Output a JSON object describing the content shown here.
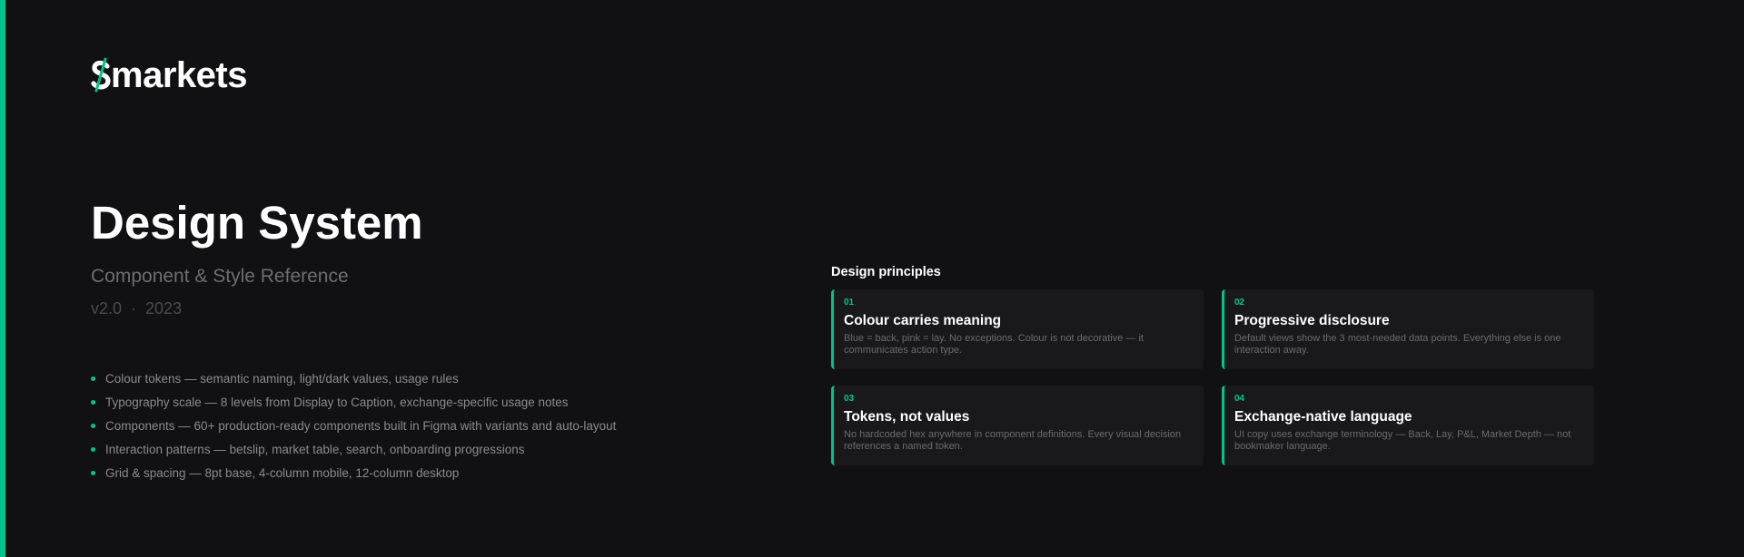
{
  "brand": {
    "logo_text": "markets",
    "accent": "#00c48c",
    "background": "#111113"
  },
  "title": "Design System",
  "subtitle": "Component & Style Reference",
  "meta": {
    "version": "v2.0",
    "separator": "·",
    "year": "2023"
  },
  "features": [
    "Colour tokens — semantic naming, light/dark values, usage rules",
    "Typography scale — 8 levels from Display to Caption, exchange-specific usage notes",
    "Components — 60+ production-ready components built in Figma with variants and auto-layout",
    "Interaction patterns — betslip, market table, search, onboarding progressions",
    "Grid & spacing — 8pt base, 4-column mobile, 12-column desktop"
  ],
  "principles": {
    "heading": "Design principles",
    "items": [
      {
        "num": "01",
        "title": "Colour carries meaning",
        "desc": "Blue = back, pink = lay. No exceptions. Colour is not decorative — it communicates action type."
      },
      {
        "num": "02",
        "title": "Progressive disclosure",
        "desc": "Default views show the 3 most-needed data points. Everything else is one interaction away."
      },
      {
        "num": "03",
        "title": "Tokens, not values",
        "desc": "No hardcoded hex anywhere in component definitions. Every visual decision references a named token."
      },
      {
        "num": "04",
        "title": "Exchange-native language",
        "desc": "UI copy uses exchange terminology — Back, Lay, P&L, Market Depth — not bookmaker language."
      }
    ]
  }
}
